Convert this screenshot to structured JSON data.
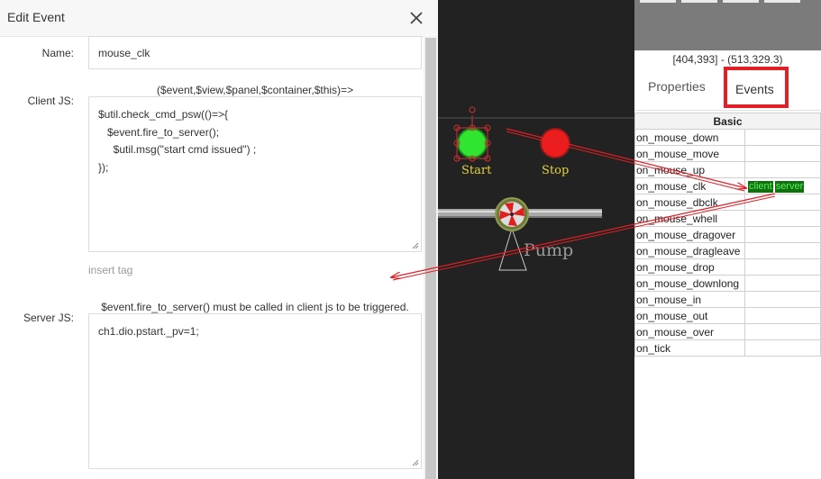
{
  "dialog": {
    "title": "Edit Event",
    "name_label": "Name:",
    "name_value": "mouse_clk",
    "client_label": "Client JS:",
    "client_signature": "($event,$view,$panel,$container,$this)=>",
    "client_code": "$util.check_cmd_psw(()=>{\n   $event.fire_to_server();\n     $util.msg(\"start cmd issued\") ;\n});",
    "insert_tag": "insert tag",
    "server_note": "$event.fire_to_server() must be called in client js to be triggered.",
    "server_label": "Server JS:",
    "server_code": "ch1.dio.pstart._pv=1;"
  },
  "canvas": {
    "start_label": "Start",
    "stop_label": "Stop",
    "pump_label": "Pump",
    "background": "#222222",
    "start_color": "#2fe52f",
    "stop_color": "#ee1d1d"
  },
  "right_panel": {
    "coords": "[404,393] - (513,329.3)",
    "tabs": {
      "properties": "Properties",
      "events": "Events"
    },
    "table_header": "Basic",
    "events": [
      {
        "name": "on_mouse_down"
      },
      {
        "name": "on_mouse_move"
      },
      {
        "name": "on_mouse_up"
      },
      {
        "name": "on_mouse_clk",
        "client": "client",
        "server": "server"
      },
      {
        "name": "on_mouse_dbclk"
      },
      {
        "name": "on_mouse_whell"
      },
      {
        "name": "on_mouse_dragover"
      },
      {
        "name": "on_mouse_dragleave"
      },
      {
        "name": "on_mouse_drop"
      },
      {
        "name": "on_mouse_downlong"
      },
      {
        "name": "on_mouse_in"
      },
      {
        "name": "on_mouse_out"
      },
      {
        "name": "on_mouse_over"
      },
      {
        "name": "on_tick"
      }
    ],
    "highlight_color": "#e01f26"
  }
}
